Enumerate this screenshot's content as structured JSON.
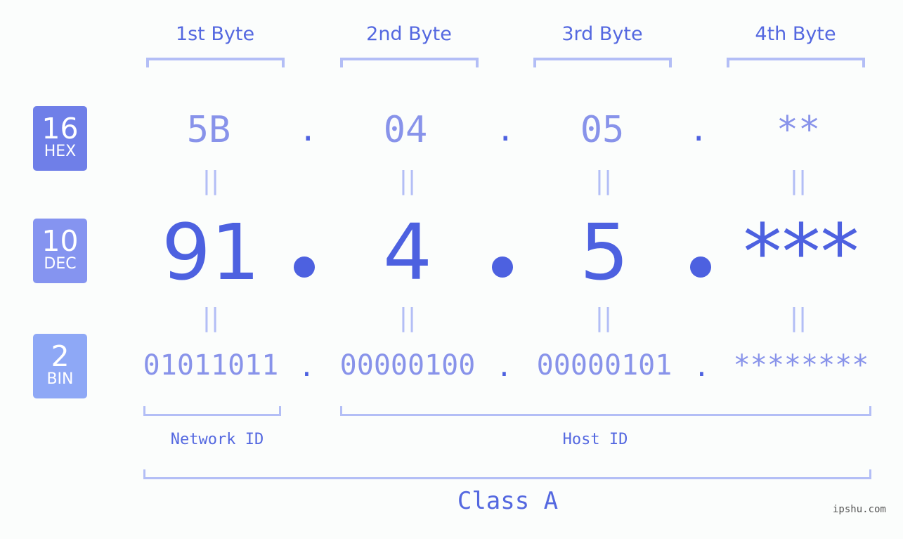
{
  "byte_headers": [
    "1st Byte",
    "2nd Byte",
    "3rd Byte",
    "4th Byte"
  ],
  "badges": {
    "hex": {
      "num": "16",
      "label": "HEX",
      "color": "#6f7fe8"
    },
    "dec": {
      "num": "10",
      "label": "DEC",
      "color": "#8594f0"
    },
    "bin": {
      "num": "2",
      "label": "BIN",
      "color": "#8ea8f6"
    }
  },
  "hex_values": [
    "5B",
    "04",
    "05",
    "**"
  ],
  "dec_values": [
    "91",
    "4",
    "5",
    "***"
  ],
  "bin_values": [
    "01011011",
    "00000100",
    "00000101",
    "********"
  ],
  "separator": ".",
  "equals": "||",
  "network_id_label": "Network ID",
  "host_id_label": "Host ID",
  "class_label": "Class A",
  "watermark": "ipshu.com",
  "colors": {
    "accent": "#4d61e0",
    "light": "#8893ea",
    "bracket": "#b3bef6"
  }
}
